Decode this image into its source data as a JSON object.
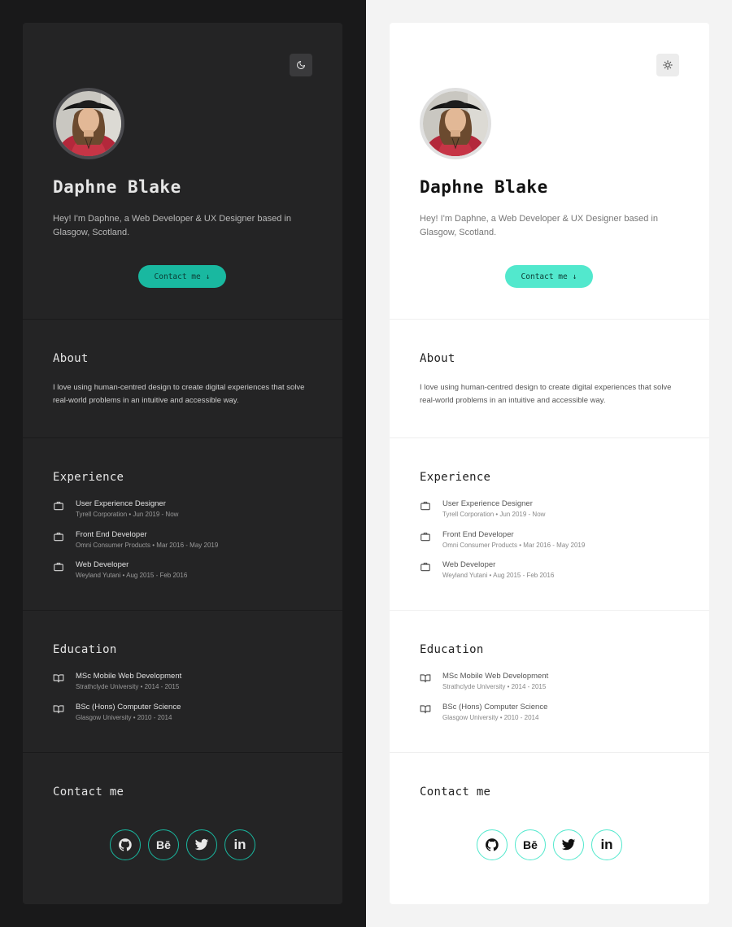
{
  "profile": {
    "name": "Daphne Blake",
    "bio": "Hey! I'm Daphne, a Web Developer & UX Designer based in Glasgow, Scotland.",
    "contact_button": "Contact me",
    "contact_arrow": "↓"
  },
  "about": {
    "title": "About",
    "text": "I love using human-centred design to create digital experiences that solve real-world problems in an intuitive and accessible way."
  },
  "experience": {
    "title": "Experience",
    "items": [
      {
        "title": "User Experience Designer",
        "sub": "Tyrell Corporation • Jun 2019 - Now"
      },
      {
        "title": "Front End Developer",
        "sub": "Omni Consumer Products • Mar 2016 - May 2019"
      },
      {
        "title": "Web Developer",
        "sub": "Weyland Yutani • Aug 2015 - Feb 2016"
      }
    ]
  },
  "education": {
    "title": "Education",
    "items": [
      {
        "title": "MSc Mobile Web Development",
        "sub": "Strathclyde University • 2014 - 2015"
      },
      {
        "title": "BSc (Hons) Computer Science",
        "sub": "Glasgow University • 2010 - 2014"
      }
    ]
  },
  "contact": {
    "title": "Contact me",
    "behance_label": "Bē",
    "linkedin_label": "in"
  },
  "colors": {
    "dark_accent": "#19b8a0",
    "light_accent": "#52e8cd"
  }
}
